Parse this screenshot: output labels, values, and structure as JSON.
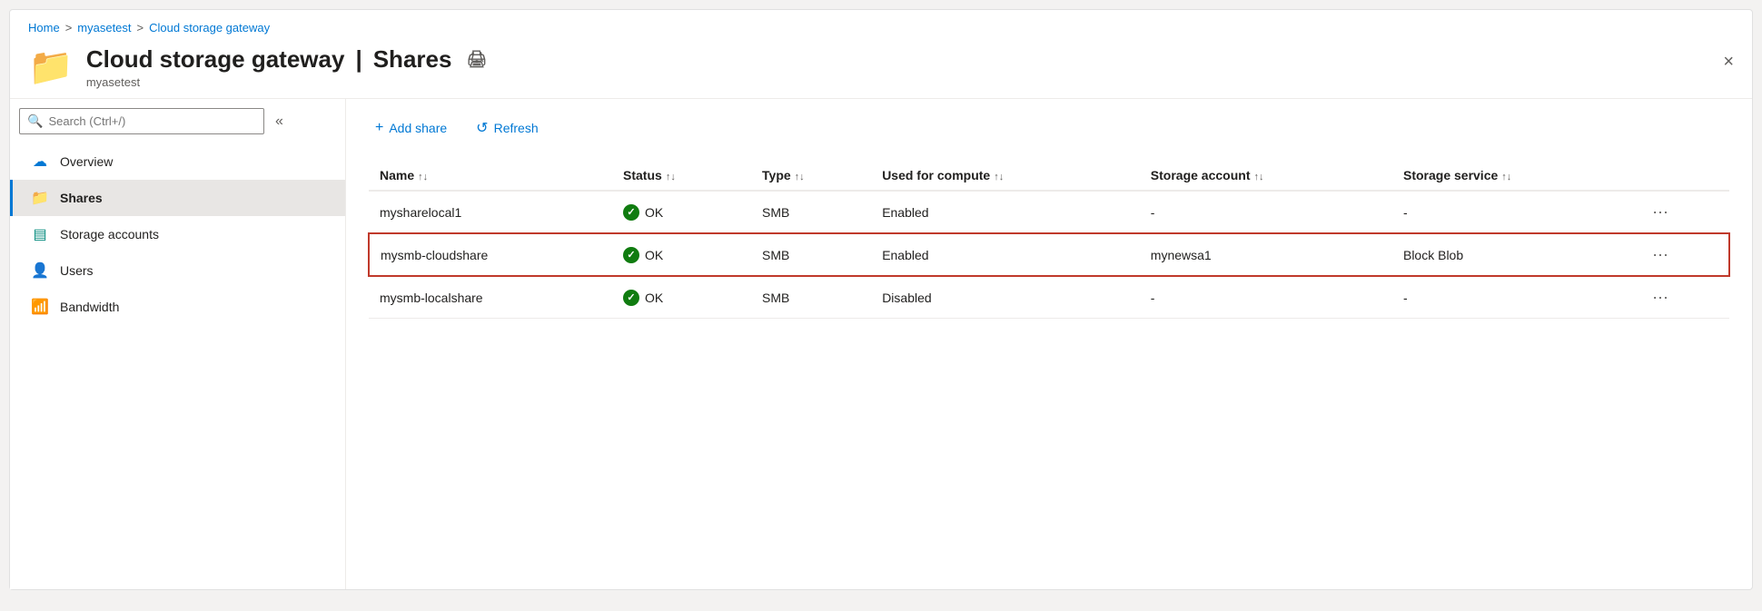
{
  "breadcrumb": {
    "home": "Home",
    "sep1": ">",
    "myasetest": "myasetest",
    "sep2": ">",
    "current": "Cloud storage gateway"
  },
  "header": {
    "icon": "📁",
    "title": "Cloud storage gateway",
    "separator": "|",
    "section": "Shares",
    "subtitle": "myasetest",
    "print_label": "print",
    "close_label": "×"
  },
  "search": {
    "placeholder": "Search (Ctrl+/)"
  },
  "collapse_btn": "«",
  "sidebar": {
    "items": [
      {
        "id": "overview",
        "label": "Overview",
        "icon": "cloud",
        "active": false
      },
      {
        "id": "shares",
        "label": "Shares",
        "icon": "folder",
        "active": true
      },
      {
        "id": "storage-accounts",
        "label": "Storage accounts",
        "icon": "storage",
        "active": false
      },
      {
        "id": "users",
        "label": "Users",
        "icon": "users",
        "active": false
      },
      {
        "id": "bandwidth",
        "label": "Bandwidth",
        "icon": "bandwidth",
        "active": false
      }
    ]
  },
  "toolbar": {
    "add_share_label": "Add share",
    "refresh_label": "Refresh"
  },
  "table": {
    "columns": [
      {
        "id": "name",
        "label": "Name"
      },
      {
        "id": "status",
        "label": "Status"
      },
      {
        "id": "type",
        "label": "Type"
      },
      {
        "id": "used_for_compute",
        "label": "Used for compute"
      },
      {
        "id": "storage_account",
        "label": "Storage account"
      },
      {
        "id": "storage_service",
        "label": "Storage service"
      },
      {
        "id": "actions",
        "label": ""
      }
    ],
    "rows": [
      {
        "name": "mysharelocal1",
        "status": "OK",
        "type": "SMB",
        "used_for_compute": "Enabled",
        "storage_account": "-",
        "storage_service": "-",
        "highlighted": false
      },
      {
        "name": "mysmb-cloudshare",
        "status": "OK",
        "type": "SMB",
        "used_for_compute": "Enabled",
        "storage_account": "mynewsa1",
        "storage_service": "Block Blob",
        "highlighted": true
      },
      {
        "name": "mysmb-localshare",
        "status": "OK",
        "type": "SMB",
        "used_for_compute": "Disabled",
        "storage_account": "-",
        "storage_service": "-",
        "highlighted": false
      }
    ]
  }
}
